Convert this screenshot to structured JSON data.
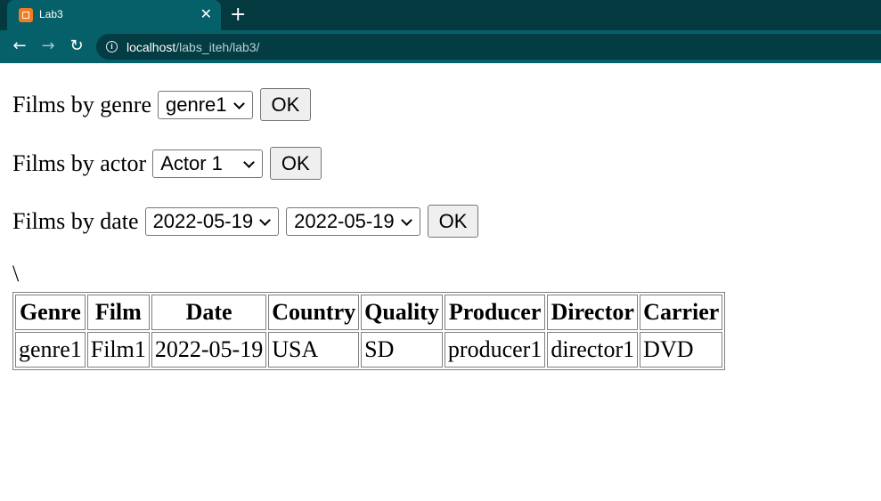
{
  "browser": {
    "tab_title": "Lab3",
    "close_label": "✕",
    "new_tab_label": "+",
    "url_host": "localhost",
    "url_path": "/labs_iteh/lab3/"
  },
  "filters": {
    "genre": {
      "label": "Films by genre",
      "selected": "genre1",
      "ok_label": "OK"
    },
    "actor": {
      "label": "Films by actor",
      "selected": "Actor 1",
      "ok_label": "OK"
    },
    "date": {
      "label": "Films by date",
      "from": "2022-05-19",
      "to": "2022-05-19",
      "ok_label": "OK"
    }
  },
  "stray_text": "\\",
  "table": {
    "headers": [
      "Genre",
      "Film",
      "Date",
      "Country",
      "Quality",
      "Producer",
      "Director",
      "Carrier"
    ],
    "rows": [
      [
        "genre1",
        "Film1",
        "2022-05-19",
        "USA",
        "SD",
        "producer1",
        "director1",
        "DVD"
      ]
    ]
  },
  "colors": {
    "tabbar": "#04393f",
    "toolbar": "#06606a",
    "favicon": "#f47c20"
  },
  "icons": {
    "back": "arrow-left",
    "forward": "arrow-right",
    "reload": "reload",
    "info": "info-circle",
    "favicon": "xampp-logo"
  }
}
